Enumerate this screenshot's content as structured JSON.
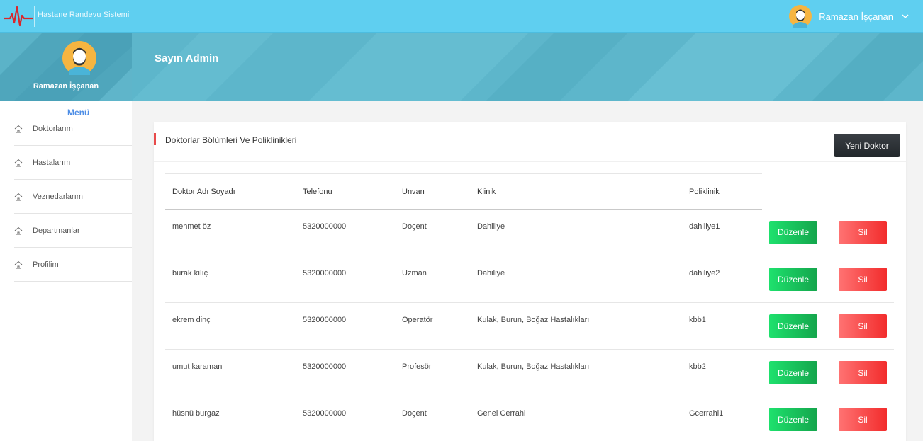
{
  "app": {
    "title": "Hastane Randevu Sistemi"
  },
  "user": {
    "name": "Ramazan İşçanan"
  },
  "sidebar": {
    "menu_title": "Menü",
    "items": [
      {
        "label": "Doktorlarım",
        "icon": "home-icon"
      },
      {
        "label": "Hastalarım",
        "icon": "home-icon"
      },
      {
        "label": "Veznedarlarım",
        "icon": "home-icon"
      },
      {
        "label": "Departmanlar",
        "icon": "home-icon"
      },
      {
        "label": "Profilim",
        "icon": "home-icon"
      }
    ]
  },
  "banner": {
    "greeting": "Sayın Admin"
  },
  "card": {
    "title": "Doktorlar Bölümleri Ve Poliklinikleri",
    "new_button": "Yeni Doktor",
    "columns": [
      "Doktor Adı Soyadı",
      "Telefonu",
      "Unvan",
      "Klinik",
      "Poliklinik"
    ],
    "edit_label": "Düzenle",
    "delete_label": "Sil",
    "rows": [
      {
        "name": "mehmet öz",
        "phone": "5320000000",
        "title": "Doçent",
        "clinic": "Dahiliye",
        "polyclinic": "dahiliye1"
      },
      {
        "name": "burak kılıç",
        "phone": "5320000000",
        "title": "Uzman",
        "clinic": "Dahiliye",
        "polyclinic": "dahiliye2"
      },
      {
        "name": "ekrem dinç",
        "phone": "5320000000",
        "title": "Operatör",
        "clinic": "Kulak, Burun, Boğaz Hastalıkları",
        "polyclinic": "kbb1"
      },
      {
        "name": "umut karaman",
        "phone": "5320000000",
        "title": "Profesör",
        "clinic": "Kulak, Burun, Boğaz Hastalıkları",
        "polyclinic": "kbb2"
      },
      {
        "name": "hüsnü burgaz",
        "phone": "5320000000",
        "title": "Doçent",
        "clinic": "Genel Cerrahi",
        "polyclinic": "Gcerrahi1"
      }
    ]
  },
  "colors": {
    "topbar": "#5fcff0",
    "banner": "#5db6cb",
    "accent": "#e84b4b",
    "edit": "#1ccf64",
    "delete": "#f54343",
    "menu_title": "#4e8ee6"
  }
}
